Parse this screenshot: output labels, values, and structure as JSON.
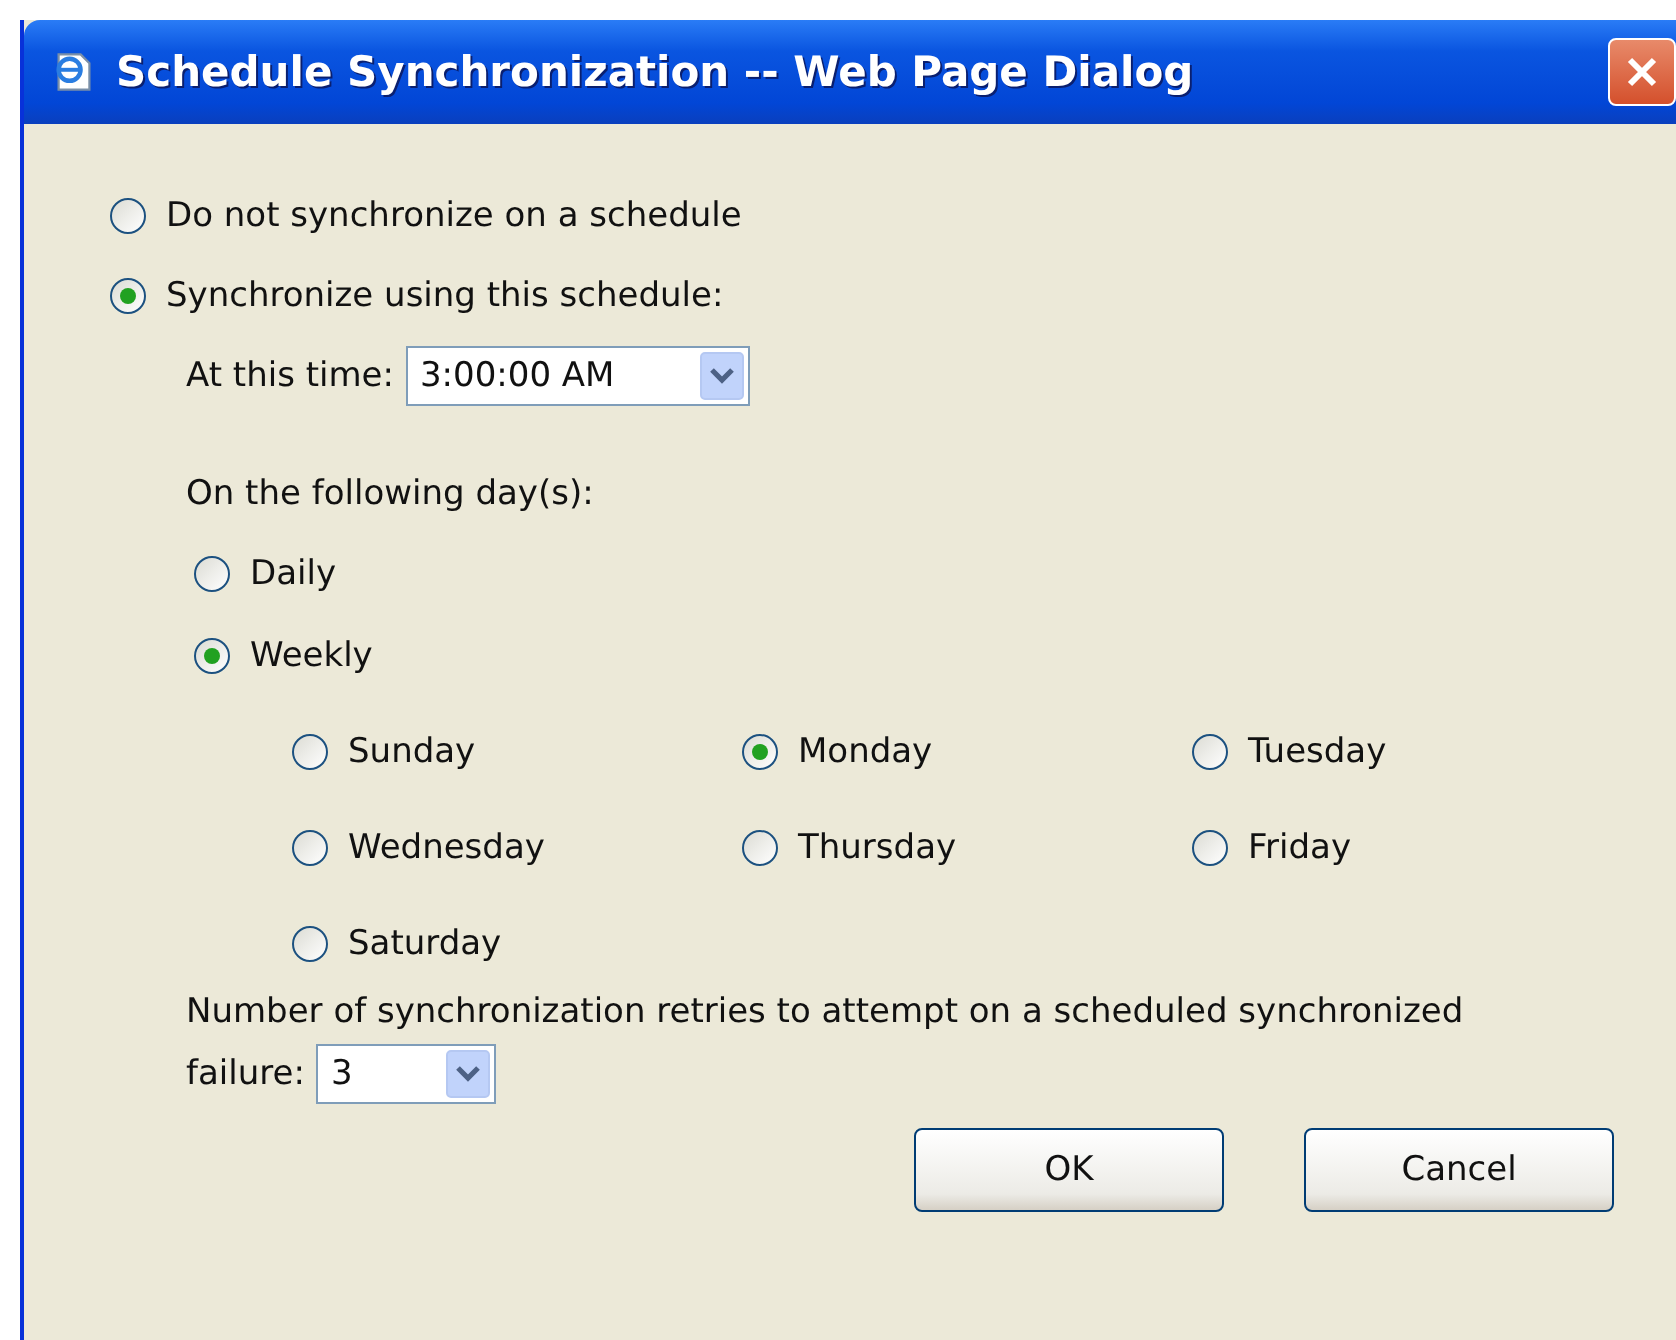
{
  "window": {
    "title": "Schedule Synchronization -- Web Page Dialog"
  },
  "schedule_options": [
    {
      "label": "Do not synchronize on a schedule",
      "selected": false
    },
    {
      "label": "Synchronize using this schedule:",
      "selected": true
    }
  ],
  "time": {
    "label": "At this time:",
    "value": "3:00:00 AM"
  },
  "days_heading": "On the following day(s):",
  "frequency": [
    {
      "label": "Daily",
      "selected": false
    },
    {
      "label": "Weekly",
      "selected": true
    }
  ],
  "weekdays": [
    {
      "label": "Sunday",
      "selected": false
    },
    {
      "label": "Monday",
      "selected": true
    },
    {
      "label": "Tuesday",
      "selected": false
    },
    {
      "label": "Wednesday",
      "selected": false
    },
    {
      "label": "Thursday",
      "selected": false
    },
    {
      "label": "Friday",
      "selected": false
    },
    {
      "label": "Saturday",
      "selected": false
    }
  ],
  "retries": {
    "label_lines": [
      "Number of synchronization retries to attempt on a scheduled synchronized",
      "failure:"
    ],
    "value": "3"
  },
  "buttons": [
    "OK",
    "Cancel"
  ]
}
